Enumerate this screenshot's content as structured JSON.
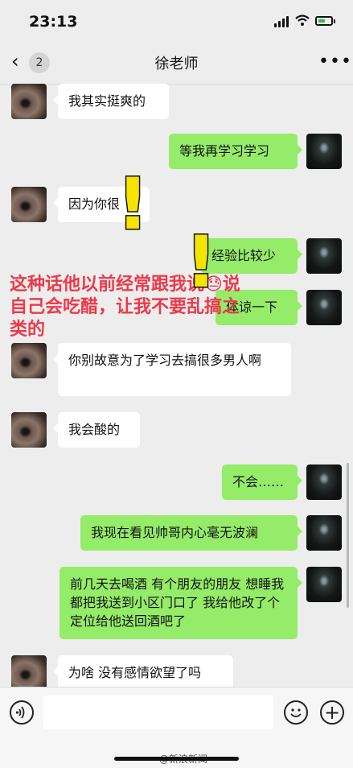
{
  "status_bar": {
    "time": "23:13",
    "icons": [
      "signal-icon",
      "wifi-icon",
      "battery-charging-icon"
    ],
    "battery_level": 0.55
  },
  "nav": {
    "back_icon": "‹",
    "unread_count": "2",
    "title": "徐老师",
    "more_icon": "•••"
  },
  "messages": [
    {
      "side": "left",
      "text": "我其实挺爽的"
    },
    {
      "side": "right",
      "text": "等我再学习学习"
    },
    {
      "side": "left",
      "text": "因为你很"
    },
    {
      "side": "right",
      "text": "经验比较少"
    },
    {
      "side": "right",
      "text": "体谅一下"
    },
    {
      "side": "left",
      "text": "你别故意为了学习去搞很多男人啊"
    },
    {
      "side": "left",
      "text": "我会酸的"
    },
    {
      "side": "right",
      "text": "不会……"
    },
    {
      "side": "right",
      "text": "我现在看见帅哥内心毫无波澜"
    },
    {
      "side": "right",
      "text": "前几天去喝酒 有个朋友的朋友 想睡我 都把我送到小区门口了 我给他改了个定位给他送回酒吧了"
    },
    {
      "side": "left",
      "text": "为啥 没有感情欲望了吗"
    }
  ],
  "annotation": {
    "text": "这种话他以前经常跟我说😓说自己会吃醋，让我不要乱搞之类的",
    "color": "#ec3a4a",
    "exclamations": [
      "!",
      "!"
    ]
  },
  "input_bar": {
    "voice_icon": "voice-icon",
    "emoji_icon": "emoji-icon",
    "plus_icon": "plus-icon",
    "watermark": "@新浪新闻"
  },
  "colors": {
    "self_bubble": "#95ec69",
    "other_bubble": "#ffffff",
    "background": "#ededed"
  }
}
